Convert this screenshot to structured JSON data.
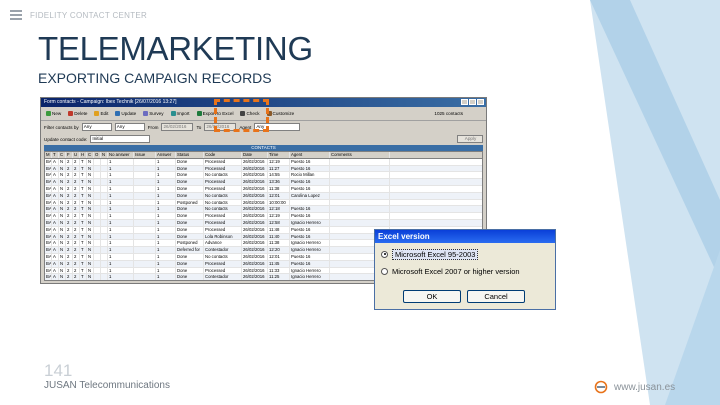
{
  "header": {
    "brand": "FIDELITY CONTACT CENTER",
    "title": "TELEMARKETING",
    "subtitle": "EXPORTING CAMPAIGN RECORDS"
  },
  "app": {
    "window_title": "Form contacts - Campaign: Ibex Technik [26/07/2016 13:27]",
    "toolbar": [
      "New",
      "Delete",
      "Edit",
      "Update",
      "Survey",
      "Import",
      "Export to Excel",
      "Check",
      "Customize"
    ],
    "contact_count": "1025 contacts",
    "filters": {
      "row1_label": "Filter contacts by",
      "row1_value": "Any",
      "row1_b": "Any",
      "from_label": "From",
      "from_date": "26/02/2016",
      "to_label": "To",
      "to_date": "26/02/2016",
      "agent_label": "Agent",
      "agent_value": "Any",
      "row2_label": "Update contact code:",
      "row2_value": "Initial",
      "apply_label": "Apply"
    },
    "grid_title": "CONTACTS",
    "columns": [
      "M",
      "T",
      "C",
      "F",
      "U",
      "H",
      "C",
      "O",
      "N",
      "No answer",
      "Issue",
      "Answer",
      "Status",
      "Code",
      "Date",
      "Time",
      "Agent",
      "Comments"
    ],
    "rows": [
      [
        "BA",
        "A",
        "N",
        "2",
        "2",
        "T",
        "N",
        "",
        "",
        "1",
        "",
        "1",
        "Done",
        "Processed",
        "26/02/2016",
        "12:19",
        "Puesto 16",
        ""
      ],
      [
        "BA",
        "A",
        "N",
        "2",
        "2",
        "T",
        "N",
        "",
        "",
        "1",
        "",
        "1",
        "Done",
        "Processed",
        "26/02/2016",
        "11:27",
        "Puesto 16",
        ""
      ],
      [
        "BA",
        "A",
        "N",
        "2",
        "2",
        "T",
        "N",
        "",
        "",
        "1",
        "",
        "1",
        "Done",
        "No contacts",
        "26/02/2016",
        "14:55",
        "Rocio Millan",
        ""
      ],
      [
        "BA",
        "A",
        "N",
        "2",
        "2",
        "T",
        "N",
        "",
        "",
        "1",
        "",
        "1",
        "Done",
        "Processed",
        "26/02/2016",
        "13:36",
        "Puesto 16",
        ""
      ],
      [
        "BA",
        "A",
        "N",
        "2",
        "2",
        "T",
        "N",
        "",
        "",
        "1",
        "",
        "1",
        "Done",
        "Processed",
        "26/02/2016",
        "11:38",
        "Puesto 16",
        ""
      ],
      [
        "BA",
        "A",
        "N",
        "2",
        "2",
        "T",
        "N",
        "",
        "",
        "1",
        "",
        "1",
        "Done",
        "No contacts",
        "26/02/2016",
        "12:01",
        "Carolina Lopez",
        ""
      ],
      [
        "BA",
        "A",
        "N",
        "2",
        "2",
        "T",
        "N",
        "",
        "",
        "1",
        "",
        "1",
        "Postponed",
        "No contacts",
        "26/02/2016",
        "10:00:00",
        "",
        ""
      ],
      [
        "BA",
        "A",
        "N",
        "2",
        "2",
        "T",
        "N",
        "",
        "",
        "1",
        "",
        "1",
        "Done",
        "No contacts",
        "26/02/2016",
        "12:18",
        "Puesto 16",
        ""
      ],
      [
        "BA",
        "A",
        "N",
        "2",
        "2",
        "T",
        "N",
        "",
        "",
        "1",
        "",
        "1",
        "Done",
        "Processed",
        "26/02/2016",
        "12:19",
        "Puesto 16",
        ""
      ],
      [
        "BA",
        "A",
        "N",
        "2",
        "2",
        "T",
        "N",
        "",
        "",
        "1",
        "",
        "1",
        "Done",
        "Processed",
        "26/02/2016",
        "12:58",
        "Ignacio Herrero",
        ""
      ],
      [
        "BA",
        "A",
        "N",
        "2",
        "2",
        "T",
        "N",
        "",
        "",
        "1",
        "",
        "1",
        "Done",
        "Processed",
        "26/02/2016",
        "11:48",
        "Puesto 16",
        ""
      ],
      [
        "BA",
        "A",
        "N",
        "2",
        "2",
        "T",
        "N",
        "",
        "",
        "1",
        "",
        "1",
        "Done",
        "Lola Robinson",
        "26/02/2016",
        "11:40",
        "Puesto 16",
        ""
      ],
      [
        "BA",
        "A",
        "N",
        "2",
        "2",
        "T",
        "N",
        "",
        "",
        "1",
        "",
        "1",
        "Postponed",
        "Advance",
        "26/02/2016",
        "11:38",
        "Ignacio Herrero",
        ""
      ],
      [
        "BA",
        "A",
        "N",
        "2",
        "2",
        "T",
        "N",
        "",
        "",
        "1",
        "",
        "1",
        "Deferred for",
        "Contestador",
        "26/02/2016",
        "12:20",
        "Ignacio Herrero",
        ""
      ],
      [
        "BA",
        "A",
        "N",
        "2",
        "2",
        "T",
        "N",
        "",
        "",
        "1",
        "",
        "1",
        "Done",
        "No contacts",
        "26/02/2016",
        "12:01",
        "Puesto 16",
        ""
      ],
      [
        "BA",
        "A",
        "N",
        "2",
        "2",
        "T",
        "N",
        "",
        "",
        "1",
        "",
        "1",
        "Done",
        "Processed",
        "26/02/2016",
        "11:45",
        "Puesto 16",
        ""
      ],
      [
        "BA",
        "A",
        "N",
        "2",
        "2",
        "T",
        "N",
        "",
        "",
        "1",
        "",
        "1",
        "Done",
        "Processed",
        "26/02/2016",
        "11:33",
        "Ignacio Herrero",
        ""
      ],
      [
        "BA",
        "A",
        "N",
        "2",
        "2",
        "T",
        "N",
        "",
        "",
        "1",
        "",
        "1",
        "Done",
        "Contestador",
        "26/02/2016",
        "11:25",
        "Ignacio Herrero",
        ""
      ],
      [
        "BA",
        "A",
        "N",
        "2",
        "2",
        "T",
        "N",
        "",
        "",
        "1",
        "",
        "1",
        "Done",
        "No contacts",
        "26/02/2016",
        "11:19",
        "Ignacio Herrero",
        ""
      ],
      [
        "BA",
        "A",
        "N",
        "2",
        "2",
        "T",
        "N",
        "",
        "",
        "1",
        "",
        "1",
        "Done",
        "Processed",
        "26/02/2016",
        "12:36",
        "Eduardo Perez",
        ""
      ]
    ]
  },
  "dialog": {
    "title": "Excel version",
    "option1": "Microsoft Excel 95-2003",
    "option2": "Microsoft Excel 2007 or higher version",
    "ok": "OK",
    "cancel": "Cancel"
  },
  "footer": {
    "page_number": "141",
    "company": "JUSAN Telecommunications",
    "website": "www.jusan.es"
  },
  "colors": {
    "title": "#1f3a55",
    "highlight": "#e8731a",
    "deco_light": "#cfe3f1",
    "deco_mid": "#a8cce6"
  }
}
